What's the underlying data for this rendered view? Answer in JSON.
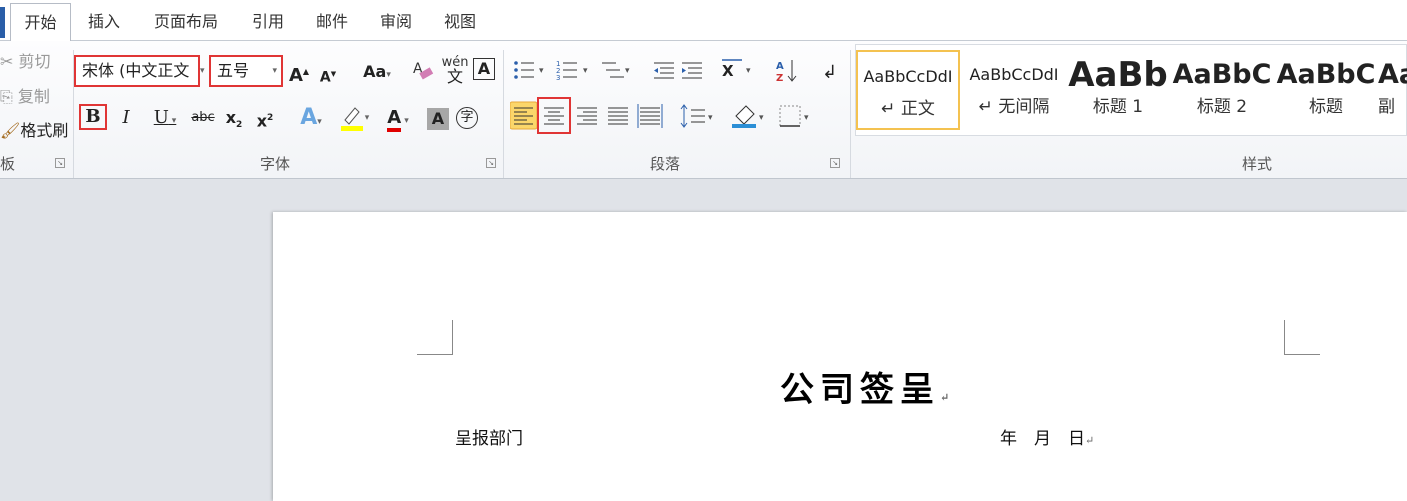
{
  "tabs": [
    "开始",
    "插入",
    "页面布局",
    "引用",
    "邮件",
    "审阅",
    "视图"
  ],
  "clipboard": {
    "cut": "剪切",
    "copy": "复制",
    "format_painter": "格式刷",
    "group_label": "板"
  },
  "font": {
    "font_name": "宋体 (中文正文",
    "font_size": "五号",
    "group_label": "字体",
    "underline": "U",
    "strikethrough": "abc",
    "bold": "B",
    "italic": "I",
    "change_case": "Aa",
    "clear_format": "A",
    "phonetic": "wén",
    "char_border": "A",
    "font_color": "A",
    "char_shade": "A",
    "enclose": "字"
  },
  "paragraph": {
    "group_label": "段落"
  },
  "styles": {
    "group_label": "样式",
    "items": [
      {
        "preview": "AaBbCcDdI",
        "name": "↵ 正文"
      },
      {
        "preview": "AaBbCcDdI",
        "name": "↵ 无间隔"
      },
      {
        "preview": "AaBb",
        "name": "标题 1"
      },
      {
        "preview": "AaBbC",
        "name": "标题 2"
      },
      {
        "preview": "AaBbC",
        "name": "标题"
      },
      {
        "preview": "Aa",
        "name": "副"
      }
    ]
  },
  "document": {
    "title": "公司签呈",
    "department": "呈报部门",
    "date": "年　月　日",
    "para_mark": "↵"
  },
  "colors": {
    "highlight": "#ffff00",
    "font_color": "#e00000",
    "accent_border": "#e03535",
    "style_selected": "#f4c250"
  }
}
